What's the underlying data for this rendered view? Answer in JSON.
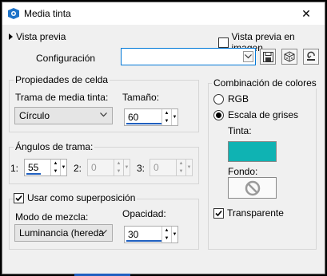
{
  "window": {
    "title": "Media tinta",
    "close_label": "✕"
  },
  "preview": {
    "toggle_label": "Vista previa",
    "checkbox_label": "Vista previa en imagen",
    "checked": false
  },
  "config": {
    "label": "Configuración",
    "value": ""
  },
  "cell_props": {
    "title": "Propiedades de celda",
    "pattern_label": "Trama de media tinta:",
    "pattern_value": "Círculo",
    "size_label": "Tamaño:",
    "size_value": "60"
  },
  "angles": {
    "title": "Ángulos de trama:",
    "items": [
      {
        "label": "1:",
        "value": "55",
        "enabled": true
      },
      {
        "label": "2:",
        "value": "0",
        "enabled": false
      },
      {
        "label": "3:",
        "value": "0",
        "enabled": false
      }
    ]
  },
  "overlay": {
    "checkbox_label": "Usar como superposición",
    "checked": true,
    "blend_label": "Modo de mezcla:",
    "blend_value": "Luminancia (hereda",
    "opacity_label": "Opacidad:",
    "opacity_value": "30"
  },
  "colors": {
    "title": "Combinación de colores",
    "rgb_label": "RGB",
    "grayscale_label": "Escala de grises",
    "selected": "grayscale",
    "ink_label": "Tinta:",
    "ink_color": "#0fb3b3",
    "background_label": "Fondo:",
    "background_icon": "no-color-icon",
    "transparent_label": "Transparente",
    "transparent_checked": true
  }
}
